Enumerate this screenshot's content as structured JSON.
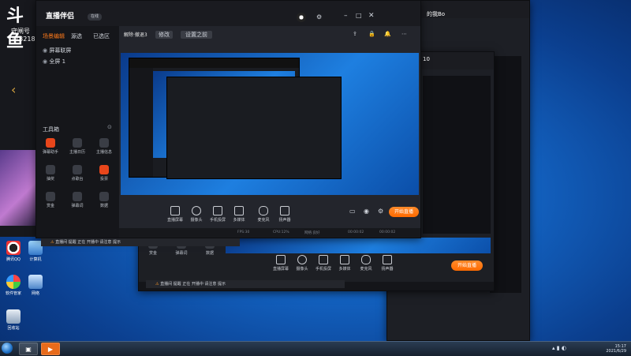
{
  "app": {
    "logo_text": "斗鱼",
    "logo_suffix": "直播伴侣",
    "user_label": "守闸号",
    "room_id": "1132181",
    "status_badge": "在线",
    "level": "10",
    "viewer_name": "的我Bo",
    "scene_title": "解除·撤退3",
    "scene_badge": "修改",
    "scene_link": "设置之前",
    "nav_tabs": [
      {
        "label": "场景编辑"
      },
      {
        "label": "源选"
      },
      {
        "label": "已选区"
      }
    ],
    "sources": [
      {
        "label": "屏幕联屏"
      },
      {
        "label": "全屏 1"
      }
    ],
    "toolbox_title": "工具箱",
    "tools": [
      {
        "label": "弹幕助手"
      },
      {
        "label": "主播日历"
      },
      {
        "label": "主播信息"
      },
      {
        "label": "抽奖"
      },
      {
        "label": "点歌台"
      },
      {
        "label": "投票"
      },
      {
        "label": "赏金"
      },
      {
        "label": "弹幕词"
      },
      {
        "label": "数据"
      }
    ],
    "preview_ctrls": [
      {
        "label": "直播屏幕",
        "icon": "screen-icon"
      },
      {
        "label": "摄像头",
        "icon": "camera-icon"
      },
      {
        "label": "手机投屏",
        "icon": "phone-icon"
      },
      {
        "label": "多媒体",
        "icon": "media-icon"
      },
      {
        "label": "麦克风",
        "icon": "mic-icon"
      },
      {
        "label": "扬声器",
        "icon": "speaker-icon"
      }
    ],
    "start_button": "开始直播",
    "status_bar": {
      "fps": "FPS:30",
      "cpu": "CPU:12%",
      "net": "网络:良好",
      "time": "00:00:02",
      "time2": "00:00:02"
    },
    "notice": "直播间 提醒 正在 开播中 请注意 提示"
  },
  "desktop": {
    "icons": [
      {
        "label": "腾讯QQ"
      },
      {
        "label": "计算机"
      },
      {
        "label": "软件管家"
      },
      {
        "label": "网络"
      },
      {
        "label": "回收站"
      }
    ]
  },
  "taskbar": {
    "time": "15:17",
    "date": "2021/6/29"
  },
  "colors": {
    "accent": "#ff6a00",
    "desktop": "#1363c2"
  }
}
